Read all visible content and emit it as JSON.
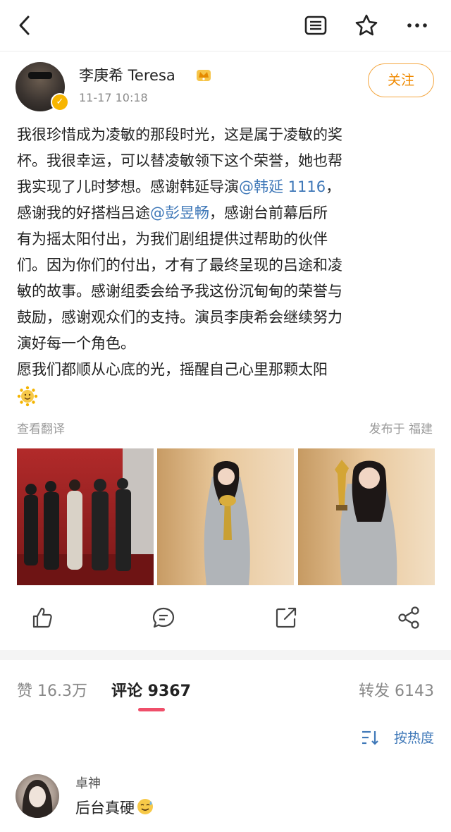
{
  "header": {
    "back_icon": "chevron-left-icon",
    "icons": [
      "notes-icon",
      "star-icon",
      "more-icon"
    ]
  },
  "post": {
    "author": "李庚希 Teresa",
    "time": "11-17 10:18",
    "follow_label": "关注",
    "lines": [
      [
        {
          "t": "我很珍惜成为凌敏的那段时光，这是属于凌敏的奖"
        }
      ],
      [
        {
          "t": "杯。我很幸运，可以替凌敏领下这个荣誉，她也帮"
        }
      ],
      [
        {
          "t": "我实现了儿时梦想。感谢韩延导演"
        },
        {
          "t": "@韩延 1116",
          "m": true
        },
        {
          "t": "，"
        }
      ],
      [
        {
          "t": "感谢我的好搭档吕途"
        },
        {
          "t": "@彭昱畅",
          "m": true
        },
        {
          "t": "，感谢台前幕后所"
        }
      ],
      [
        {
          "t": "有为摇太阳付出，为我们剧组提供过帮助的伙伴"
        }
      ],
      [
        {
          "t": "们。因为你们的付出，才有了最终呈现的吕途和凌"
        }
      ],
      [
        {
          "t": "敏的故事。感谢组委会给予我这份沉甸甸的荣誉与"
        }
      ],
      [
        {
          "t": "鼓励，感谢观众们的支持。演员李庚希会继续努力"
        }
      ],
      [
        {
          "t": "演好每一个角色。"
        }
      ],
      [
        {
          "t": "愿我们都顺从心底的光，摇醒自己心里那颗太阳"
        }
      ]
    ],
    "emoji": "sun-smile-icon",
    "translate_label": "查看翻译",
    "location": "发布于 福建"
  },
  "actions": [
    "thumbs-up-icon",
    "comment-icon",
    "share-out-icon",
    "forward-icon"
  ],
  "stats": {
    "likes": "赞 16.3万",
    "comments": "评论 9367",
    "reposts": "转发 6143"
  },
  "sort_label": "按热度",
  "comment": {
    "name": "卓神",
    "text": "后台真硬"
  },
  "colors": {
    "accent_orange": "#f08a00",
    "link_blue": "#3f78b8",
    "tab_underline": "#ef4f6a"
  }
}
